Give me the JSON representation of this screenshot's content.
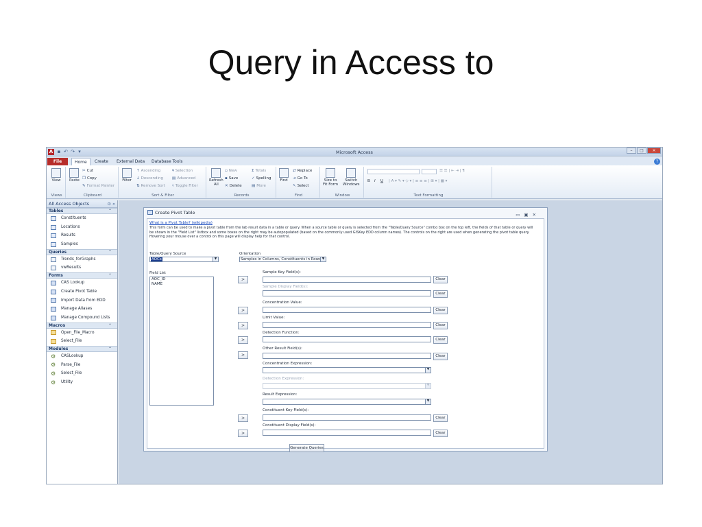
{
  "slide": {
    "title": "Query in Access to"
  },
  "window": {
    "title": "Microsoft Access",
    "app_icon": "A"
  },
  "tabs": {
    "file": "File",
    "home": "Home",
    "create": "Create",
    "external": "External Data",
    "dbtools": "Database Tools"
  },
  "ribbon": {
    "views": {
      "view": "View",
      "label": "Views"
    },
    "clipboard": {
      "paste": "Paste",
      "cut": "Cut",
      "copy": "Copy",
      "format_painter": "Format Painter",
      "label": "Clipboard"
    },
    "sort_filter": {
      "filter": "Filter",
      "ascending": "Ascending",
      "descending": "Descending",
      "remove_sort": "Remove Sort",
      "selection": "Selection",
      "advanced": "Advanced",
      "toggle_filter": "Toggle Filter",
      "label": "Sort & Filter"
    },
    "records": {
      "refresh": "Refresh",
      "refresh_all": "All",
      "new": "New",
      "save": "Save",
      "delete": "Delete",
      "totals": "Totals",
      "spelling": "Spelling",
      "more": "More",
      "label": "Records"
    },
    "find": {
      "find": "Find",
      "replace": "Replace",
      "goto": "Go To",
      "select": "Select",
      "label": "Find"
    },
    "window": {
      "size_to_fit": "Size to",
      "size_to_fit2": "Fit Form",
      "switch": "Switch",
      "switch2": "Windows",
      "label": "Window"
    },
    "text_formatting": {
      "bold": "B",
      "italic": "I",
      "underline": "U",
      "label": "Text Formatting"
    }
  },
  "nav": {
    "header": "All Access Objects",
    "sections": {
      "tables": {
        "label": "Tables",
        "items": [
          "Constituents",
          "Locations",
          "Results",
          "Samples"
        ]
      },
      "queries": {
        "label": "Queries",
        "items": [
          "Trends_forGraphs",
          "vwResults"
        ]
      },
      "forms": {
        "label": "Forms",
        "items": [
          "CAS Lookup",
          "Create Pivot Table",
          "Import Data from EDD",
          "Manage Aliases",
          "Manage Compound Lists"
        ]
      },
      "macros": {
        "label": "Macros",
        "items": [
          "Open_File_Macro",
          "Select_File"
        ]
      },
      "modules": {
        "label": "Modules",
        "items": [
          "CASLookup",
          "Parse_File",
          "Select_File",
          "Utility"
        ]
      }
    }
  },
  "form": {
    "title": "Create Pivot Table",
    "wiki_link": "What is a Pivot Table? (wikipedia)",
    "description": "This form can be used to make a pivot table from the lab result data in a table or query. When a source table or query is selected from the \"Table/Query Source\" combo box on the top left, the fields of that table or query will be shown in the \"Field List\" listbox and some boxes on the right may be autopopulated (based on the commonly used GISKey EDD column names). The controls on the right are used when generating the pivot table query. Hovering your mouse over a control on this page will display help for that control.",
    "source_label": "Table/Query Source",
    "source_value": "AOCs",
    "orientation_label": "Orientation",
    "orientation_value": "Samples in Columns, Constituents in Rows",
    "field_list_label": "Field List",
    "field_list": [
      "AOC_ID",
      "NAME"
    ],
    "fields": {
      "sample_key": "Sample Key Field(s):",
      "sample_display": "Sample Display Field(s):",
      "concentration": "Concentration Value:",
      "limit": "Limit Value:",
      "detection_function": "Detection Function:",
      "other_result": "Other Result Field(s):",
      "concentration_expr": "Concentration Expression:",
      "detection_expr": "Detection Expression:",
      "result_expr": "Result Expression:",
      "constituent_key": "Constituent Key Field(s):",
      "constituent_display": "Constituent Display Field(s):"
    },
    "arrow_label": ">",
    "clear_label": "Clear",
    "generate_label": "Generate Queries"
  }
}
